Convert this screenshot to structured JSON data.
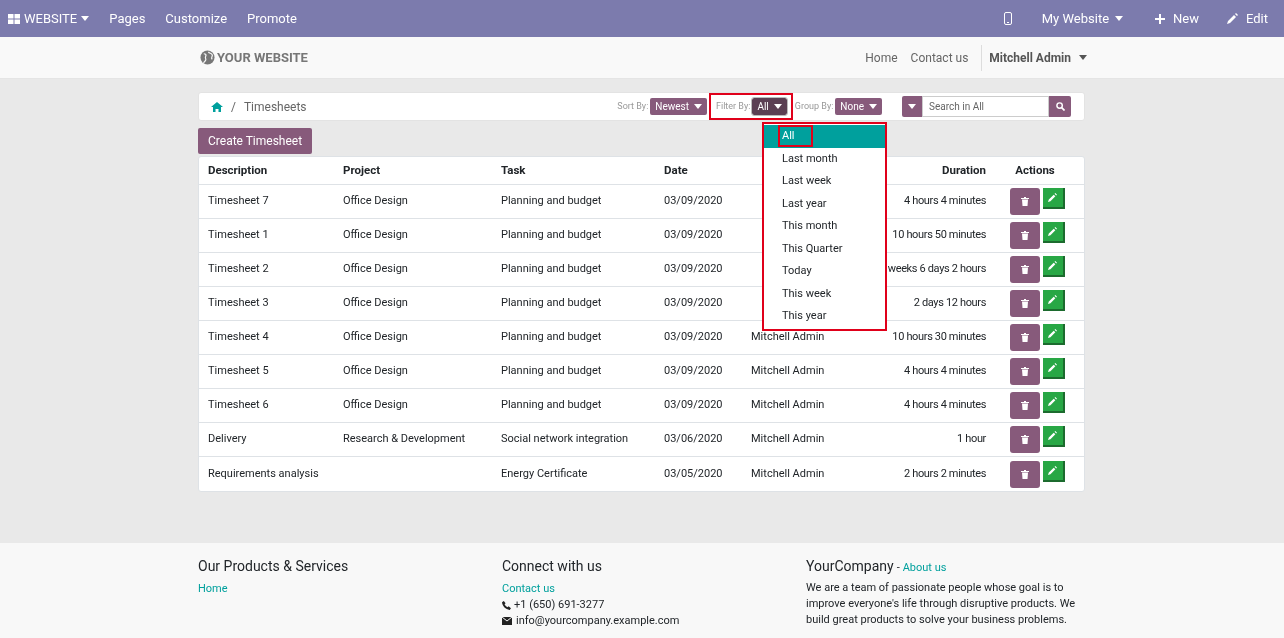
{
  "top_bar": {
    "app_menu": "WEBSITE",
    "menu": [
      "Pages",
      "Customize",
      "Promote"
    ],
    "site_menu": "My Website",
    "new_button": "New",
    "edit_button": "Edit"
  },
  "header": {
    "logo": "YOUR WEBSITE",
    "nav": [
      "Home",
      "Contact us"
    ],
    "user": "Mitchell Admin"
  },
  "breadcrumb_separator": "/",
  "breadcrumb": "Timesheets",
  "controls": {
    "sort_label": "Sort By:",
    "sort_value": "Newest",
    "filter_label": "Filter By:",
    "filter_value": "All",
    "group_label": "Group By:",
    "group_value": "None",
    "search_placeholder": "Search in All"
  },
  "filter_menu": [
    {
      "label": "All",
      "selected": true
    },
    {
      "label": "Last month",
      "selected": false
    },
    {
      "label": "Last week",
      "selected": false
    },
    {
      "label": "Last year",
      "selected": false
    },
    {
      "label": "This month",
      "selected": false
    },
    {
      "label": "This Quarter",
      "selected": false
    },
    {
      "label": "Today",
      "selected": false
    },
    {
      "label": "This week",
      "selected": false
    },
    {
      "label": "This year",
      "selected": false
    }
  ],
  "create_button": "Create Timesheet",
  "table": {
    "columns": [
      "Description",
      "Project",
      "Task",
      "Date",
      "",
      "Duration",
      "Actions"
    ],
    "rows": [
      {
        "description": "Timesheet 7",
        "project": "Office Design",
        "task": "Planning and budget",
        "date": "03/09/2020",
        "duration": "4 hours 4 minutes"
      },
      {
        "description": "Timesheet 1",
        "project": "Office Design",
        "task": "Planning and budget",
        "date": "03/09/2020",
        "duration": "10 hours 50 minutes"
      },
      {
        "description": "Timesheet 2",
        "project": "Office Design",
        "task": "Planning and budget",
        "date": "03/09/2020",
        "duration": "weeks 6 days 2 hours"
      },
      {
        "description": "Timesheet 3",
        "project": "Office Design",
        "task": "Planning and budget",
        "date": "03/09/2020",
        "duration": "2 days 12 hours"
      },
      {
        "description": "Timesheet 4",
        "project": "Office Design",
        "task": "Planning and budget",
        "date": "03/09/2020",
        "employee": "Mitchell Admin",
        "duration": "10 hours 30 minutes"
      },
      {
        "description": "Timesheet 5",
        "project": "Office Design",
        "task": "Planning and budget",
        "date": "03/09/2020",
        "employee": "Mitchell Admin",
        "duration": "4 hours 4 minutes"
      },
      {
        "description": "Timesheet 6",
        "project": "Office Design",
        "task": "Planning and budget",
        "date": "03/09/2020",
        "employee": "Mitchell Admin",
        "duration": "4 hours 4 minutes"
      },
      {
        "description": "Delivery",
        "project": "Research & Development",
        "task": "Social network integration",
        "date": "03/06/2020",
        "employee": "Mitchell Admin",
        "duration": "1 hour"
      },
      {
        "description": "Requirements analysis",
        "task": "Energy Certificate",
        "date": "03/05/2020",
        "employee": "Mitchell Admin",
        "duration": "2 hours 2 minutes"
      }
    ]
  },
  "footer": {
    "col1_title": "Our Products & Services",
    "col1_links": [
      "Home"
    ],
    "col2_title": "Connect with us",
    "col2_link": "Contact us",
    "phone": "+1 (650) 691-3277",
    "email": "info@yourcompany.example.com",
    "col3_title": "YourCompany",
    "col3_sep": "-",
    "col3_link": "About us",
    "about": "We are a team of passionate people whose goal is to improve everyone's life through disruptive products. We build great products to solve your business problems."
  }
}
